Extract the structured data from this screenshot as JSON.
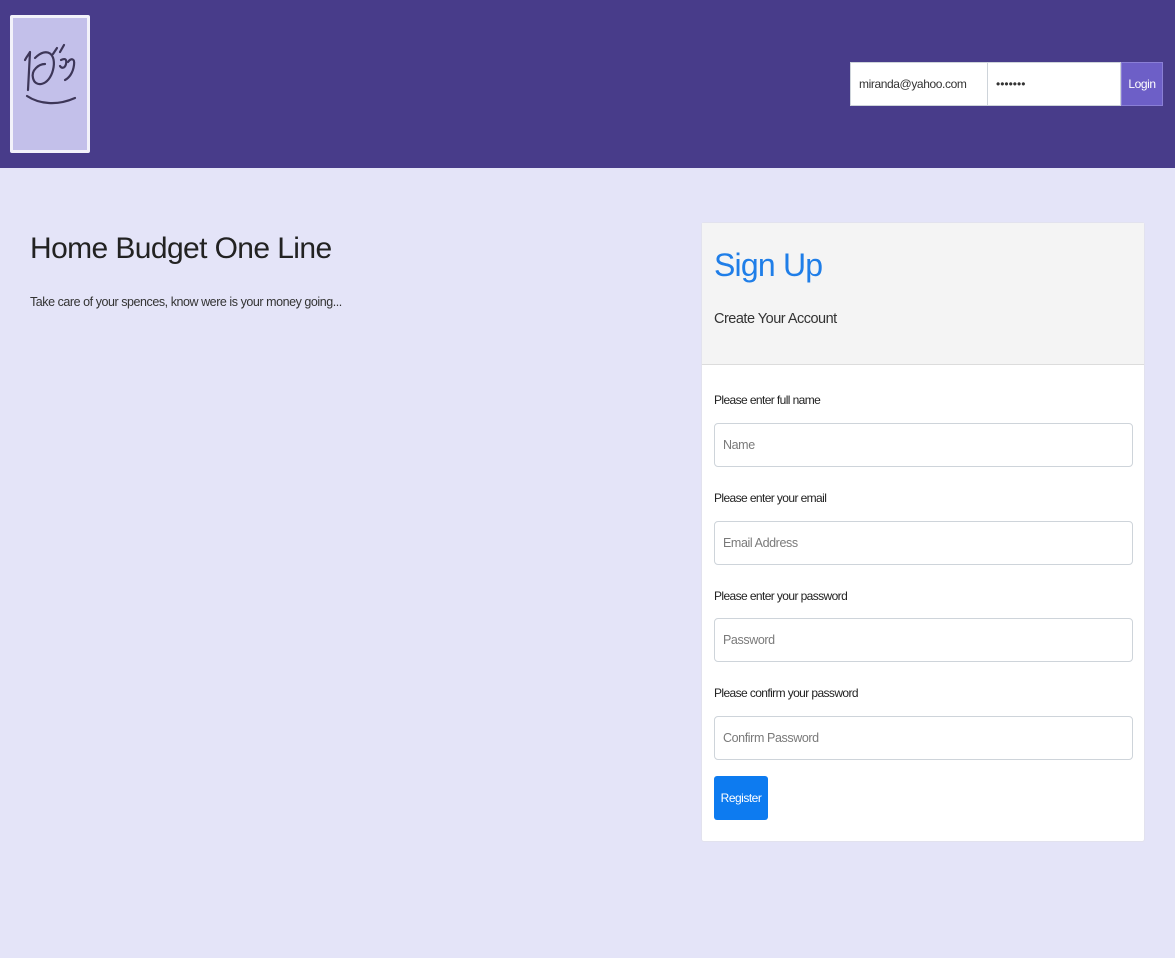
{
  "header": {
    "logo_icon": "handwritten-logo-icon",
    "background_color": "#483c8a",
    "login": {
      "email_value": "miranda@yahoo.com",
      "password_value": "*******",
      "button_label": "Login"
    }
  },
  "hero": {
    "title": "Home Budget One Line",
    "subtitle": "Take care of your spences, know were is your money going..."
  },
  "signup": {
    "title": "Sign Up",
    "subtitle": "Create Your Account",
    "fields": [
      {
        "label": "Please enter full name",
        "placeholder": "Name",
        "type": "text"
      },
      {
        "label": "Please enter your email",
        "placeholder": "Email Address",
        "type": "email"
      },
      {
        "label": "Please enter your password",
        "placeholder": "Password",
        "type": "password"
      },
      {
        "label": "Please confirm your password",
        "placeholder": "Confirm Password",
        "type": "password"
      }
    ],
    "register_label": "Register",
    "title_color": "#1f7ee8",
    "button_color": "#0d7bf0"
  }
}
